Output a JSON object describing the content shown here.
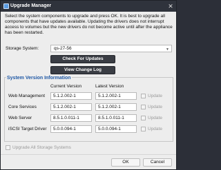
{
  "window": {
    "title": "Upgrade Manager",
    "close_glyph": "✕"
  },
  "intro": "Select the system components to upgrade and press OK. It is best to upgrade all components that have updates available. Updating the drivers does not interrupt access to volumes but the new drivers do not become active until after the appliance has been restarted.",
  "storage": {
    "label": "Storage System:",
    "value": "qs-27-56"
  },
  "buttons": {
    "check": "Check For Updates",
    "changelog": "View Change Log",
    "ok": "OK",
    "cancel": "Cancel"
  },
  "group": {
    "title": "System Version Information",
    "col_current": "Current Version",
    "col_latest": "Latest Version",
    "update_label": "Update",
    "rows": [
      {
        "name": "Web Management",
        "current": "5.1.2.002-1",
        "latest": "5.1.2.002-1"
      },
      {
        "name": "Core Services",
        "current": "5.1.2.002-1",
        "latest": "5.1.2.002-1"
      },
      {
        "name": "Web Server",
        "current": "8.5.1.0.011-1",
        "latest": "8.5.1.0.011-1"
      },
      {
        "name": "iSCSI Target Driver",
        "current": "5.0.0.094-1",
        "latest": "5.0.0.094-1"
      }
    ]
  },
  "upgrade_all": "Upgrade All Storage Systems"
}
